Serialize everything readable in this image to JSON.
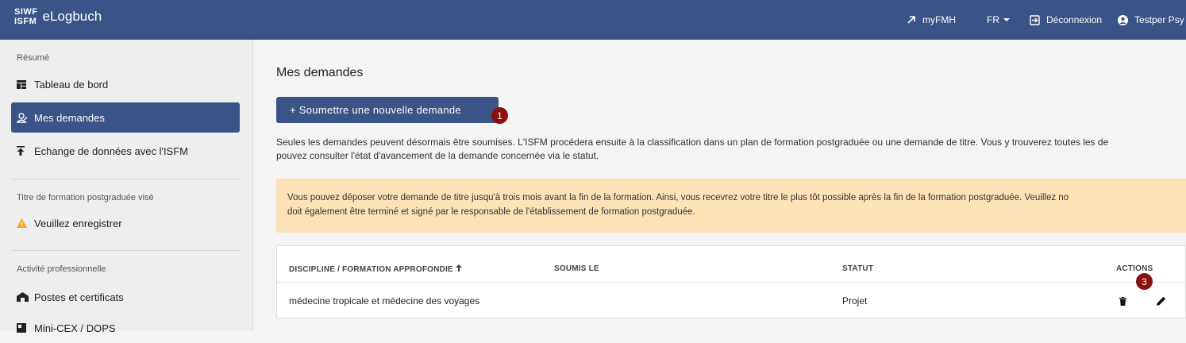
{
  "header": {
    "logo_top": "SIWF",
    "logo_bottom": "ISFM",
    "app_name": "eLogbuch",
    "myfmh": "myFMH",
    "lang": "FR",
    "logout": "Déconnexion",
    "user": "Testper Psy"
  },
  "sidebar": {
    "section_resume": "Résumé",
    "items_resume": [
      {
        "label": "Tableau de bord",
        "icon": "dashboard-icon"
      },
      {
        "label": "Mes demandes",
        "icon": "requests-icon"
      },
      {
        "label": "Echange de données avec l'ISFM",
        "icon": "upload-icon"
      }
    ],
    "section_title": "Titre de formation postgraduée visé",
    "title_item": {
      "label": "Veuillez enregistrer",
      "icon": "warning-icon"
    },
    "section_activity": "Activité professionnelle",
    "items_activity": [
      {
        "label": "Postes et certificats",
        "icon": "building-icon"
      },
      {
        "label": "Mini-CEX / DOPS",
        "icon": "clipboard-icon"
      }
    ]
  },
  "main": {
    "title": "Mes demandes",
    "submit_button": "+  Soumettre une nouvelle demande",
    "badge_1": "1",
    "badge_3": "3",
    "intro_line1": "Seules les demandes peuvent désormais être soumises. L'ISFM procédera ensuite à la classification dans un plan de formation postgraduée ou une demande de titre. Vous y trouverez toutes les de",
    "intro_line2": "pouvez consulter l'état d'avancement de la demande concernée via le statut.",
    "alert_line1": "Vous pouvez déposer votre demande de titre jusqu'à trois mois avant la fin de la formation. Ainsi, vous recevrez votre titre le plus tôt possible après la fin de la formation postgraduée. Veuillez no",
    "alert_line2": "doit également être terminé et signé par le responsable de l'établissement de formation postgraduée."
  },
  "table": {
    "headers": {
      "discipline": "DISCIPLINE / FORMATION APPROFONDIE",
      "submitted": "SOUMIS LE",
      "status": "STATUT",
      "actions": "ACTIONS"
    },
    "rows": [
      {
        "discipline": "médecine tropicale et médecine des voyages",
        "submitted": "",
        "status": "Projet"
      }
    ]
  },
  "colors": {
    "primary": "#3a5487",
    "badge": "#8a1010",
    "alert_bg": "#fde2b8",
    "warning": "#f5a623"
  }
}
